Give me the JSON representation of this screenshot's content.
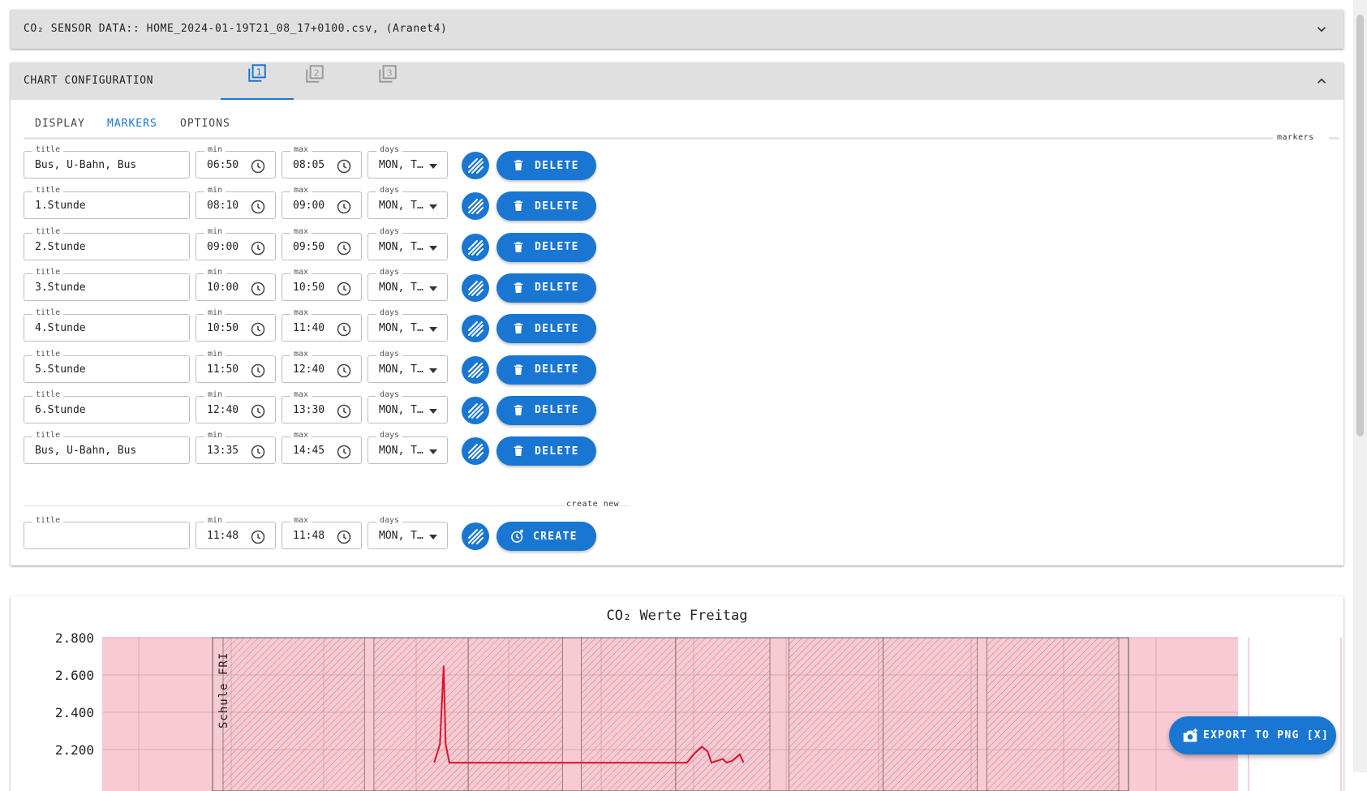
{
  "sensor_panel": {
    "title": "CO₂ SENSOR DATA:: HOME_2024-01-19T21_08_17+0100.csv, (Aranet4)"
  },
  "config_panel": {
    "title": "CHART CONFIGURATION",
    "chart_tabs": [
      "1",
      "2",
      "3"
    ],
    "active_chart_tab": 0,
    "subtabs": [
      "DISPLAY",
      "MARKERS",
      "OPTIONS"
    ],
    "active_subtab": 1,
    "markers_label": "markers",
    "field_labels": {
      "title": "title",
      "min": "min",
      "max": "max",
      "days": "days"
    },
    "delete_label": "DELETE",
    "markers": [
      {
        "title": "Bus, U-Bahn, Bus",
        "min": "06:50",
        "max": "08:05",
        "days": "MON, T…"
      },
      {
        "title": "1.Stunde",
        "min": "08:10",
        "max": "09:00",
        "days": "MON, T…"
      },
      {
        "title": "2.Stunde",
        "min": "09:00",
        "max": "09:50",
        "days": "MON, T…"
      },
      {
        "title": "3.Stunde",
        "min": "10:00",
        "max": "10:50",
        "days": "MON, T…"
      },
      {
        "title": "4.Stunde",
        "min": "10:50",
        "max": "11:40",
        "days": "MON, T…"
      },
      {
        "title": "5.Stunde",
        "min": "11:50",
        "max": "12:40",
        "days": "MON, T…"
      },
      {
        "title": "6.Stunde",
        "min": "12:40",
        "max": "13:30",
        "days": "MON, T…"
      },
      {
        "title": "Bus, U-Bahn, Bus",
        "min": "13:35",
        "max": "14:45",
        "days": "MON, T…"
      }
    ],
    "create_new_label": "create new",
    "new_marker": {
      "title": "",
      "min": "11:48",
      "max": "11:48",
      "days": "MON, T…"
    },
    "create_label": "CREATE"
  },
  "chart": {
    "export_label": "EXPORT TO PNG [X]",
    "marker_label": "Schule FRI"
  },
  "chart_data": {
    "type": "line",
    "title": "CO₂ Werte Freitag",
    "y_tick_labels": [
      "2.800",
      "2.600",
      "2.400",
      "2.200"
    ],
    "ylim_visible": [
      2150,
      2800
    ],
    "marker_bands": [
      {
        "min": "06:50",
        "max": "08:05"
      },
      {
        "min": "08:10",
        "max": "09:00"
      },
      {
        "min": "09:00",
        "max": "09:50"
      },
      {
        "min": "10:00",
        "max": "10:50"
      },
      {
        "min": "10:50",
        "max": "11:40"
      },
      {
        "min": "11:50",
        "max": "12:40"
      },
      {
        "min": "12:40",
        "max": "13:30"
      },
      {
        "min": "13:35",
        "max": "14:45"
      }
    ],
    "series": [
      {
        "values": [
          {
            "x": "08:42",
            "y": 2130
          },
          {
            "x": "08:45",
            "y": 2230
          },
          {
            "x": "08:47",
            "y": 2650
          },
          {
            "x": "08:48",
            "y": 2230
          },
          {
            "x": "08:50",
            "y": 2130
          },
          {
            "x": "10:56",
            "y": 2130
          },
          {
            "x": "11:00",
            "y": 2180
          },
          {
            "x": "11:04",
            "y": 2215
          },
          {
            "x": "11:07",
            "y": 2190
          },
          {
            "x": "11:09",
            "y": 2130
          },
          {
            "x": "11:15",
            "y": 2150
          },
          {
            "x": "11:17",
            "y": 2130
          },
          {
            "x": "11:20",
            "y": 2140
          },
          {
            "x": "11:24",
            "y": 2175
          },
          {
            "x": "11:26",
            "y": 2130
          }
        ]
      }
    ]
  }
}
